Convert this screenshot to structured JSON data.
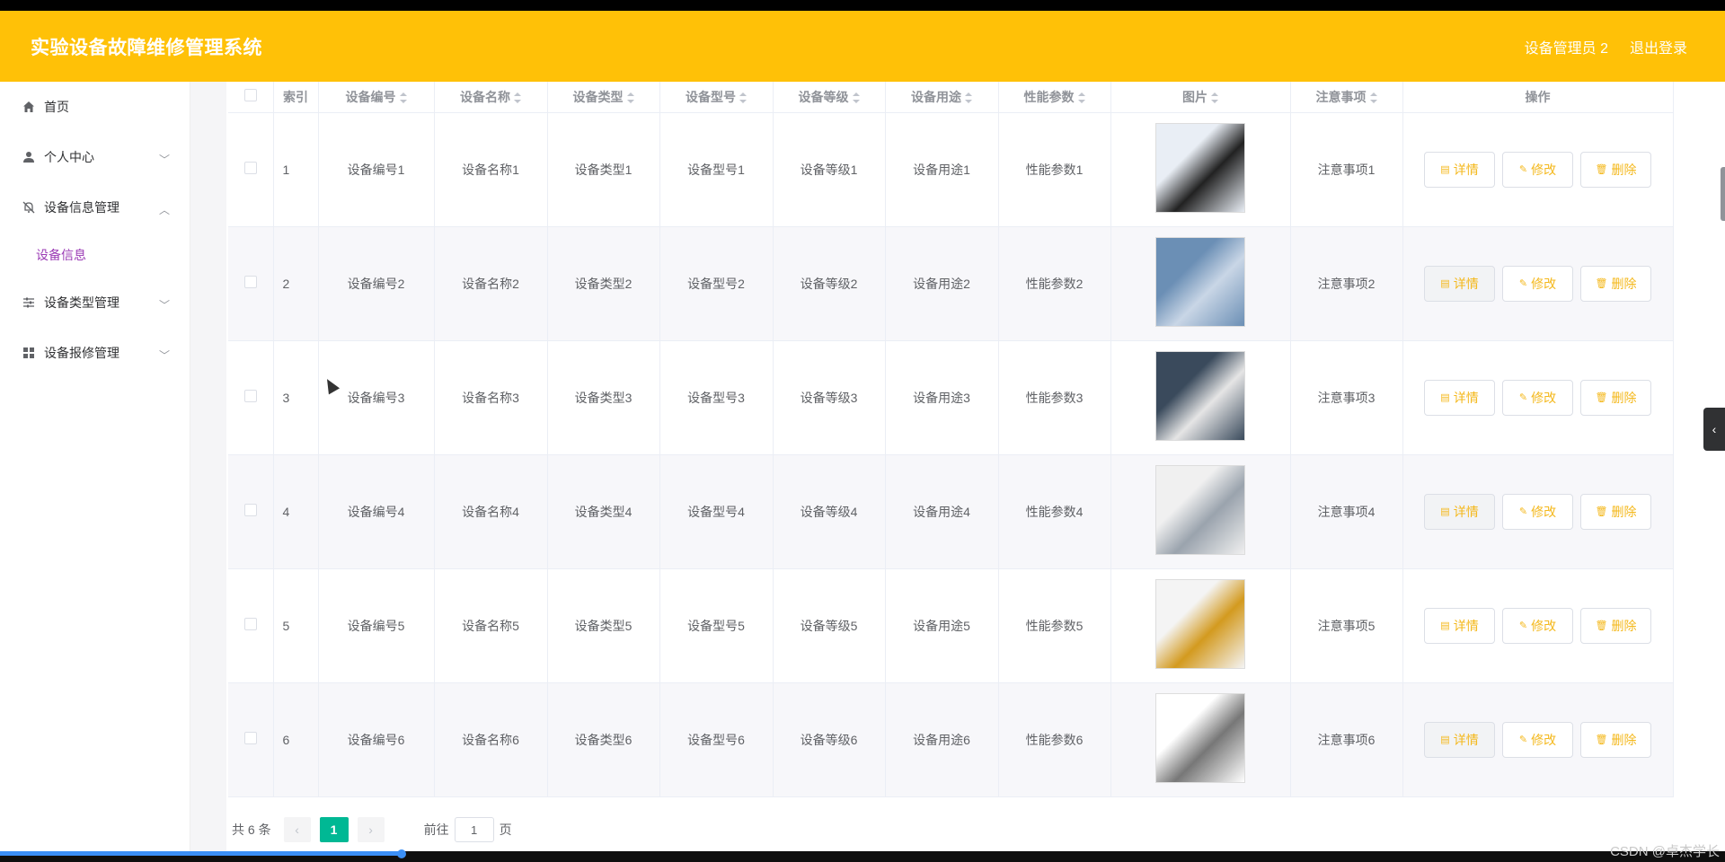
{
  "header": {
    "title": "实验设备故障维修管理系统",
    "user": "设备管理员 2",
    "logout": "退出登录"
  },
  "sidebar": {
    "items": [
      {
        "label": "首页",
        "icon": "home-icon"
      },
      {
        "label": "个人中心",
        "icon": "user-icon",
        "expanded": false
      },
      {
        "label": "设备信息管理",
        "icon": "bell-off-icon",
        "expanded": true,
        "children": [
          {
            "label": "设备信息",
            "active": true
          }
        ]
      },
      {
        "label": "设备类型管理",
        "icon": "sliders-icon",
        "expanded": false
      },
      {
        "label": "设备报修管理",
        "icon": "grid-icon",
        "expanded": false
      }
    ]
  },
  "table": {
    "columns": [
      "索引",
      "设备编号",
      "设备名称",
      "设备类型",
      "设备型号",
      "设备等级",
      "设备用途",
      "性能参数",
      "图片",
      "注意事项",
      "操作"
    ],
    "rows": [
      {
        "index": "1",
        "code": "设备编号1",
        "name": "设备名称1",
        "type": "设备类型1",
        "model": "设备型号1",
        "level": "设备等级1",
        "usage": "设备用途1",
        "params": "性能参数1",
        "notes": "注意事项1"
      },
      {
        "index": "2",
        "code": "设备编号2",
        "name": "设备名称2",
        "type": "设备类型2",
        "model": "设备型号2",
        "level": "设备等级2",
        "usage": "设备用途2",
        "params": "性能参数2",
        "notes": "注意事项2"
      },
      {
        "index": "3",
        "code": "设备编号3",
        "name": "设备名称3",
        "type": "设备类型3",
        "model": "设备型号3",
        "level": "设备等级3",
        "usage": "设备用途3",
        "params": "性能参数3",
        "notes": "注意事项3"
      },
      {
        "index": "4",
        "code": "设备编号4",
        "name": "设备名称4",
        "type": "设备类型4",
        "model": "设备型号4",
        "level": "设备等级4",
        "usage": "设备用途4",
        "params": "性能参数4",
        "notes": "注意事项4"
      },
      {
        "index": "5",
        "code": "设备编号5",
        "name": "设备名称5",
        "type": "设备类型5",
        "model": "设备型号5",
        "level": "设备等级5",
        "usage": "设备用途5",
        "params": "性能参数5",
        "notes": "注意事项5"
      },
      {
        "index": "6",
        "code": "设备编号6",
        "name": "设备名称6",
        "type": "设备类型6",
        "model": "设备型号6",
        "level": "设备等级6",
        "usage": "设备用途6",
        "params": "性能参数6",
        "notes": "注意事项6"
      }
    ],
    "actions": {
      "detail": "详情",
      "edit": "修改",
      "delete": "删除"
    }
  },
  "pagination": {
    "total_prefix": "共",
    "total": "6",
    "total_suffix": "条",
    "current_page": "1",
    "goto_prefix": "前往",
    "goto_value": "1",
    "goto_suffix": "页"
  },
  "watermark": "CSDN @卓杰学长",
  "colors": {
    "header": "#ffc107",
    "accent": "#f4b81c",
    "active_page": "#00b894",
    "submenu_active": "#9b3bb5"
  }
}
